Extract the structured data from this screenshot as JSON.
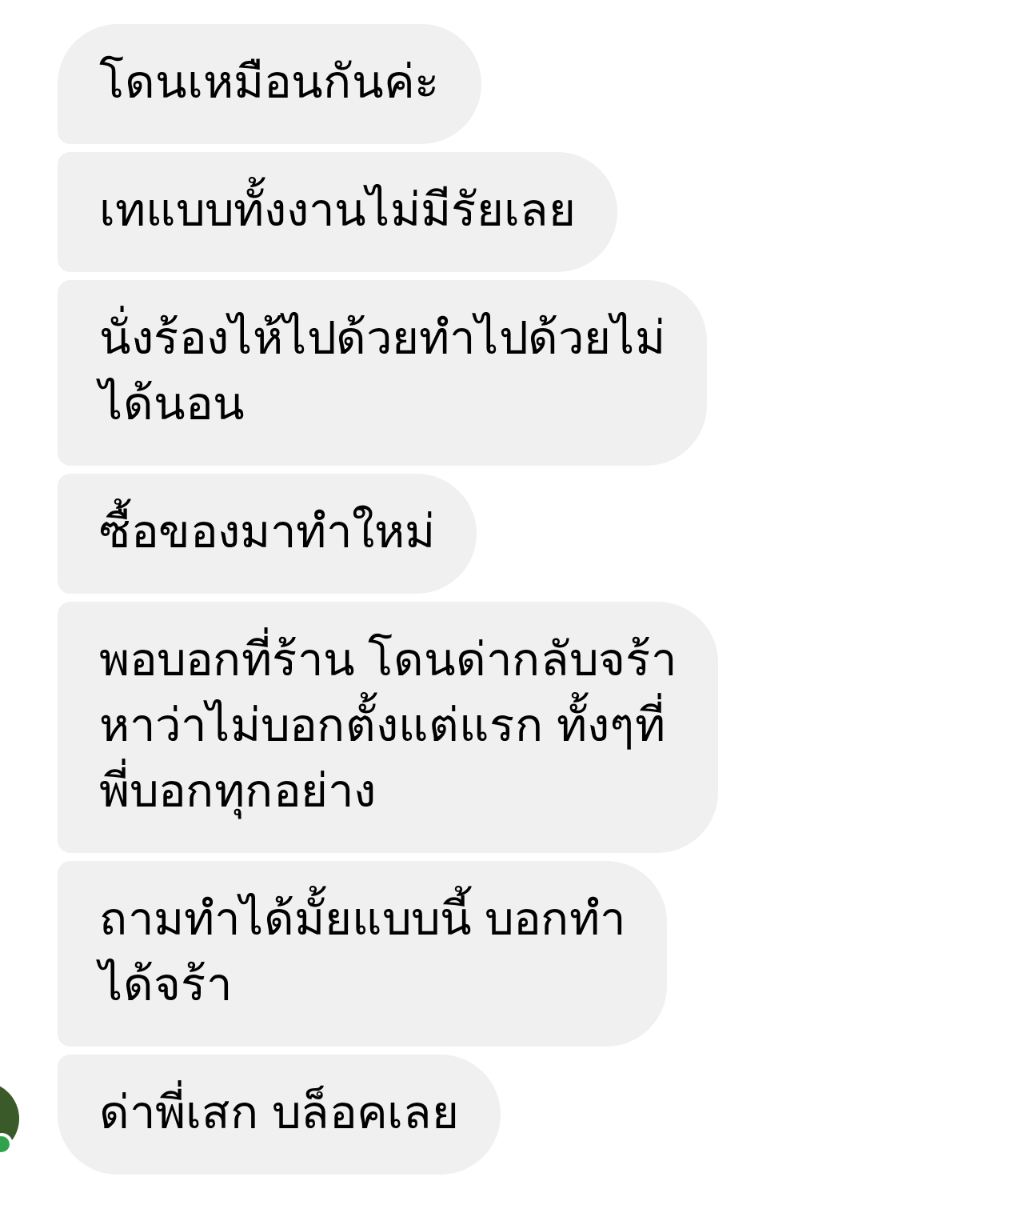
{
  "messages": [
    {
      "text": "โดนเหมือนกันค่ะ"
    },
    {
      "text": "เทแบบทั้งงานไม่มีรัยเลย"
    },
    {
      "text": "นั่งร้องไห้ไปด้วยทำไปด้วยไม่\nได้นอน"
    },
    {
      "text": "ซื้อของมาทำใหม่"
    },
    {
      "text": "พอบอกที่ร้าน โดนด่ากลับจร้า\nหาว่าไม่บอกตั้งแต่แรก ทั้งๆที่\nพี่บอกทุกอย่าง"
    },
    {
      "text": "ถามทำได้มั้ยแบบนี้ บอกทำ\nได้จร้า"
    },
    {
      "text": "ด่าพี่เสก บล็อคเลย"
    }
  ],
  "sender": {
    "online": true
  }
}
